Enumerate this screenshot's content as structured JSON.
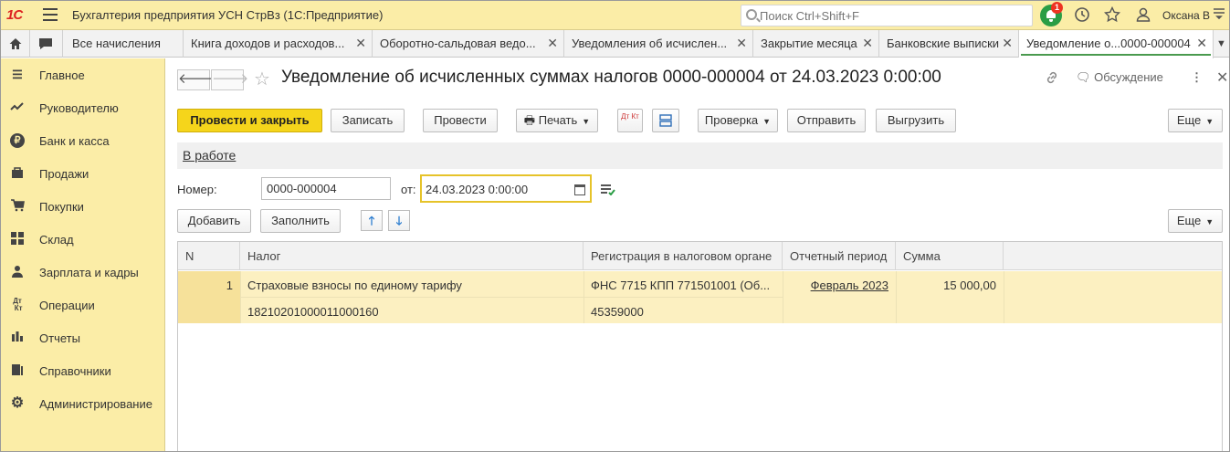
{
  "app": {
    "title": "Бухгалтерия предприятия УСН СтрВз  (1С:Предприятие)",
    "logo_text": "1С",
    "search_placeholder": "Поиск Ctrl+Shift+F",
    "notification_count": "1",
    "user_name": "Оксана В"
  },
  "tabs": [
    {
      "label": "Все начисления"
    },
    {
      "label": "Книга доходов и расходов..."
    },
    {
      "label": "Оборотно-сальдовая ведо..."
    },
    {
      "label": "Уведомления об исчислен..."
    },
    {
      "label": "Закрытие месяца"
    },
    {
      "label": "Банковские выписки"
    },
    {
      "label": "Уведомление о...0000-000004"
    }
  ],
  "sidebar": {
    "items": [
      {
        "label": "Главное",
        "icon": "menu-icon"
      },
      {
        "label": "Руководителю",
        "icon": "trend-icon"
      },
      {
        "label": "Банк и касса",
        "icon": "ruble-icon"
      },
      {
        "label": "Продажи",
        "icon": "bag-icon"
      },
      {
        "label": "Покупки",
        "icon": "cart-icon"
      },
      {
        "label": "Склад",
        "icon": "grid-icon"
      },
      {
        "label": "Зарплата и кадры",
        "icon": "person-icon"
      },
      {
        "label": "Операции",
        "icon": "dtkt-icon"
      },
      {
        "label": "Отчеты",
        "icon": "bar-chart-icon"
      },
      {
        "label": "Справочники",
        "icon": "books-icon"
      },
      {
        "label": "Администрирование",
        "icon": "gear-icon"
      }
    ]
  },
  "document": {
    "title": "Уведомление об исчисленных суммах налогов 0000-000004 от 24.03.2023 0:00:00",
    "discussion_label": "Обсуждение",
    "status_link": "В работе",
    "number_label": "Номер:",
    "number_value": "0000-000004",
    "date_label": "от:",
    "date_value": "24.03.2023  0:00:00"
  },
  "toolbar": {
    "post_close": "Провести и закрыть",
    "save": "Записать",
    "post": "Провести",
    "print": "Печать",
    "dtkt": "Дт Кт",
    "check": "Проверка",
    "send": "Отправить",
    "export": "Выгрузить",
    "more": "Еще"
  },
  "table_toolbar": {
    "add": "Добавить",
    "fill": "Заполнить",
    "more": "Еще"
  },
  "table": {
    "columns": [
      "N",
      "Налог",
      "Регистрация в налоговом органе",
      "Отчетный период",
      "Сумма"
    ],
    "rows": [
      {
        "n": "1",
        "tax": "Страховые взносы по единому тарифу",
        "kbk": "18210201000011000160",
        "registration": "ФНС 7715 КПП 771501001 (Об...",
        "oktmo": "45359000",
        "period": "Февраль 2023",
        "amount": "15 000,00"
      }
    ]
  },
  "colors": {
    "topbar": "#fbeda7",
    "primary_button": "#f5d51b",
    "selected_row": "#fcf0c1",
    "notification": "#2a9d45"
  }
}
